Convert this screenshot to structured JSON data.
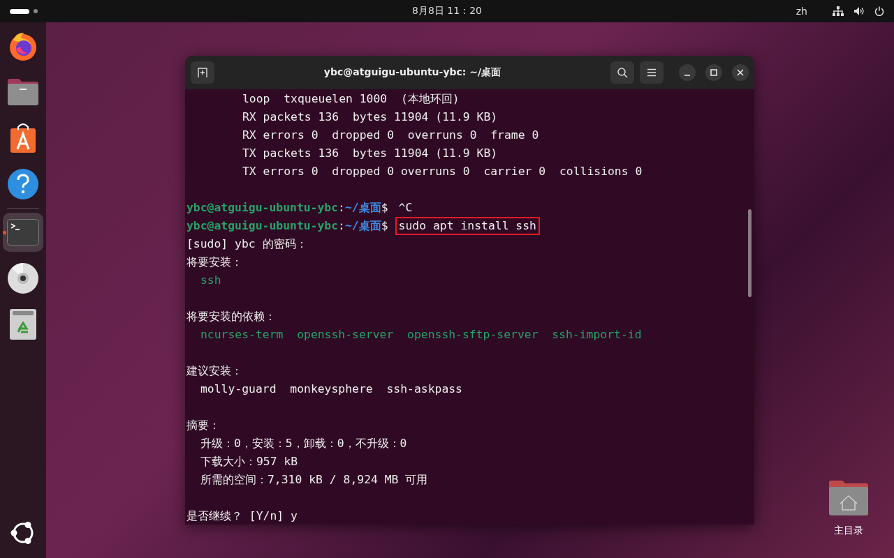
{
  "top_bar": {
    "clock": "8月8日  11：20",
    "input_method": "zh",
    "activities_selected": true
  },
  "dock": {
    "apps": [
      {
        "kind": "browser",
        "running": false
      },
      {
        "kind": "files",
        "running": false
      },
      {
        "kind": "store",
        "running": false
      },
      {
        "kind": "help",
        "running": false
      },
      {
        "kind": "terminal",
        "running": true
      },
      {
        "kind": "disc",
        "running": false
      },
      {
        "kind": "trash",
        "running": false
      }
    ]
  },
  "window": {
    "title": "ybc@atguigu-ubuntu-ybc: ~/桌面",
    "lines": [
      {
        "kind": "detail",
        "text": "loop  txqueuelen 1000  (本地环回)"
      },
      {
        "kind": "detail",
        "text": "RX packets 136  bytes 11904 (11.9 KB)"
      },
      {
        "kind": "detail",
        "text": "RX errors 0  dropped 0  overruns 0  frame 0"
      },
      {
        "kind": "detail",
        "text": "TX packets 136  bytes 11904 (11.9 KB)"
      },
      {
        "kind": "detail",
        "text": "TX errors 0  dropped 0 overruns 0  carrier 0  collisions 0"
      },
      {
        "kind": "blank"
      },
      {
        "kind": "prompt",
        "user": "ybc@atguigu-ubuntu-ybc",
        "separator": ":",
        "path": "~/桌面",
        "symbol": "$",
        "command": "^C",
        "highlighted": false
      },
      {
        "kind": "prompt",
        "user": "ybc@atguigu-ubuntu-ybc",
        "separator": ":",
        "path": "~/桌面",
        "symbol": "$",
        "command": "sudo apt install ssh",
        "highlighted": true
      },
      {
        "kind": "heading",
        "text": "[sudo] ybc 的密码："
      },
      {
        "kind": "heading",
        "text": "将要安装："
      },
      {
        "kind": "package",
        "text": "ssh"
      },
      {
        "kind": "blank"
      },
      {
        "kind": "heading",
        "text": "将要安装的依赖："
      },
      {
        "kind": "package",
        "text": "ncurses-term  openssh-server  openssh-sftp-server  ssh-import-id"
      },
      {
        "kind": "blank"
      },
      {
        "kind": "heading",
        "text": "建议安装："
      },
      {
        "kind": "item",
        "text": "molly-guard  monkeysphere  ssh-askpass"
      },
      {
        "kind": "blank"
      },
      {
        "kind": "heading",
        "text": "摘要："
      },
      {
        "kind": "item",
        "text": "升级：0，安装：5，卸载：0，不升级：0"
      },
      {
        "kind": "item",
        "text": "下载大小：957 kB"
      },
      {
        "kind": "item",
        "text": "所需的空间：7,310 kB / 8,924 MB 可用"
      },
      {
        "kind": "blank"
      },
      {
        "kind": "heading",
        "text": "是否继续？ [Y/n] y"
      }
    ]
  },
  "desktop_icons": [
    {
      "label": "主目录"
    }
  ]
}
